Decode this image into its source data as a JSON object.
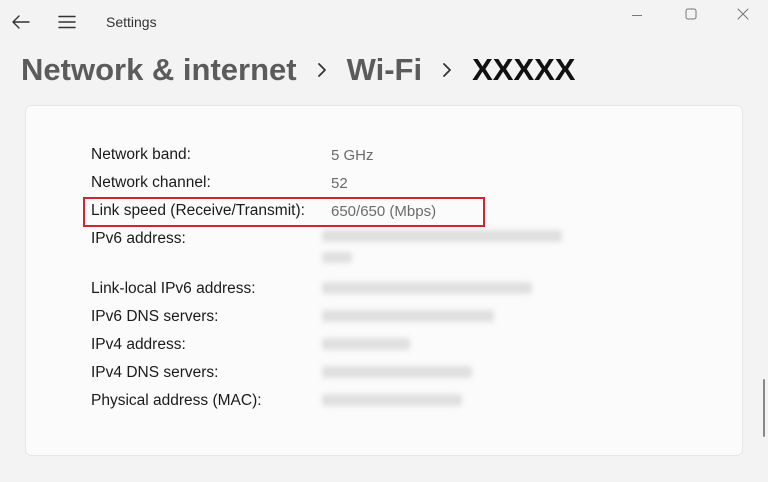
{
  "window": {
    "app_title": "Settings"
  },
  "breadcrumb": {
    "items": [
      "Network & internet",
      "Wi-Fi",
      "XXXXX"
    ]
  },
  "properties": [
    {
      "label": "Network band:",
      "value": "5 GHz"
    },
    {
      "label": "Network channel:",
      "value": "52"
    },
    {
      "label": "Link speed (Receive/Transmit):",
      "value": "650/650 (Mbps)"
    },
    {
      "label": "IPv6 address:",
      "value": ""
    },
    {
      "label": "Link-local IPv6 address:",
      "value": ""
    },
    {
      "label": "IPv6 DNS servers:",
      "value": ""
    },
    {
      "label": "IPv4 address:",
      "value": ""
    },
    {
      "label": "IPv4 DNS servers:",
      "value": ""
    },
    {
      "label": "Physical address (MAC):",
      "value": ""
    }
  ],
  "colors": {
    "highlight": "#d1242f",
    "background": "#f3f3f3",
    "card": "#fbfbfb"
  }
}
